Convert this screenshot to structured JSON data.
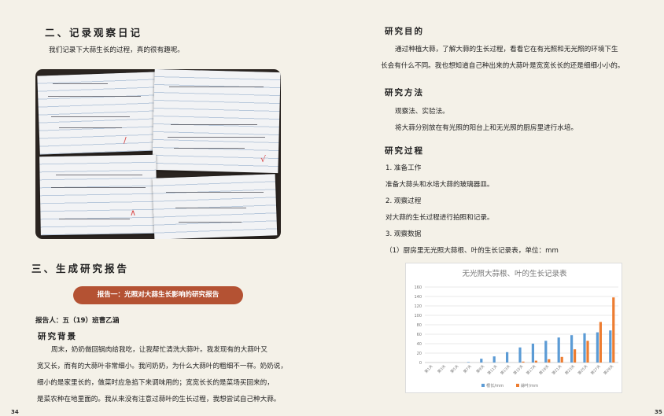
{
  "left": {
    "section2_title": "二、记录观察日记",
    "section2_text": "我们记录下大蒜生长的过程，真的很有趣呢。",
    "section3_title": "三、生成研究报告",
    "report_banner": "报告一：光照对大蒜生长影响的研究报告",
    "reporter": "报告人：五（19）班曹乙涵",
    "background_title": "研究背景",
    "background_lines": [
      "周末，奶奶做回锅肉给我吃，让我帮忙清洗大蒜叶。我发现有的大蒜叶又",
      "宽又长，而有的大蒜叶非常细小。我问奶奶，为什么大蒜叶的粗细不一样。奶奶说，",
      "细小的是家里长的，做菜时应急掐下来调味用的；宽宽长长的是菜场买回来的，",
      "是菜农种在地里面的。我从来没有注意过蒜叶的生长过程，我想尝试自己种大蒜。"
    ],
    "page_number": "34"
  },
  "right": {
    "purpose_title": "研究目的",
    "purpose_lines": [
      "通过种植大蒜，了解大蒜的生长过程，看看它在有光照和无光照的环境下生",
      "长会有什么不同。我也想知道自己种出来的大蒜叶是宽宽长长的还是细细小小的。"
    ],
    "method_title": "研究方法",
    "method_lines": [
      "观察法、实验法。",
      "将大蒜分别放在有光照的阳台上和无光照的厨房里进行水培。"
    ],
    "process_title": "研究过程",
    "process_lines": [
      "1. 准备工作",
      "准备大蒜头和水培大蒜的玻璃器皿。",
      "2. 观察过程",
      "对大蒜的生长过程进行拍照和记录。",
      "3. 观察数据",
      "（1）厨房里无光照大蒜根、叶的生长记录表，单位：mm"
    ],
    "page_number": "35"
  },
  "chart_data": {
    "type": "bar",
    "title": "无光照大蒜根、叶的生长记录表",
    "categories": [
      "第1天",
      "第3天",
      "第5天",
      "第7天",
      "第9天",
      "第11天",
      "第13天",
      "第15天",
      "第17天",
      "第19天",
      "第21天",
      "第23天",
      "第25天",
      "第27天",
      "第29天"
    ],
    "series": [
      {
        "name": "根长/mm",
        "color": "#5b9bd5",
        "values": [
          0,
          0,
          0,
          1,
          8,
          13,
          22,
          32,
          40,
          46,
          53,
          58,
          62,
          64,
          68
        ]
      },
      {
        "name": "蒜叶/mm",
        "color": "#ed7d31",
        "values": [
          0,
          0,
          0,
          0,
          0,
          0,
          0,
          2,
          4,
          7,
          12,
          28,
          46,
          86,
          138
        ]
      }
    ],
    "ylim": [
      0,
      160
    ],
    "yticks": [
      0,
      20,
      40,
      60,
      80,
      100,
      120,
      140,
      160
    ],
    "legend_position": "bottom",
    "grid": true
  }
}
